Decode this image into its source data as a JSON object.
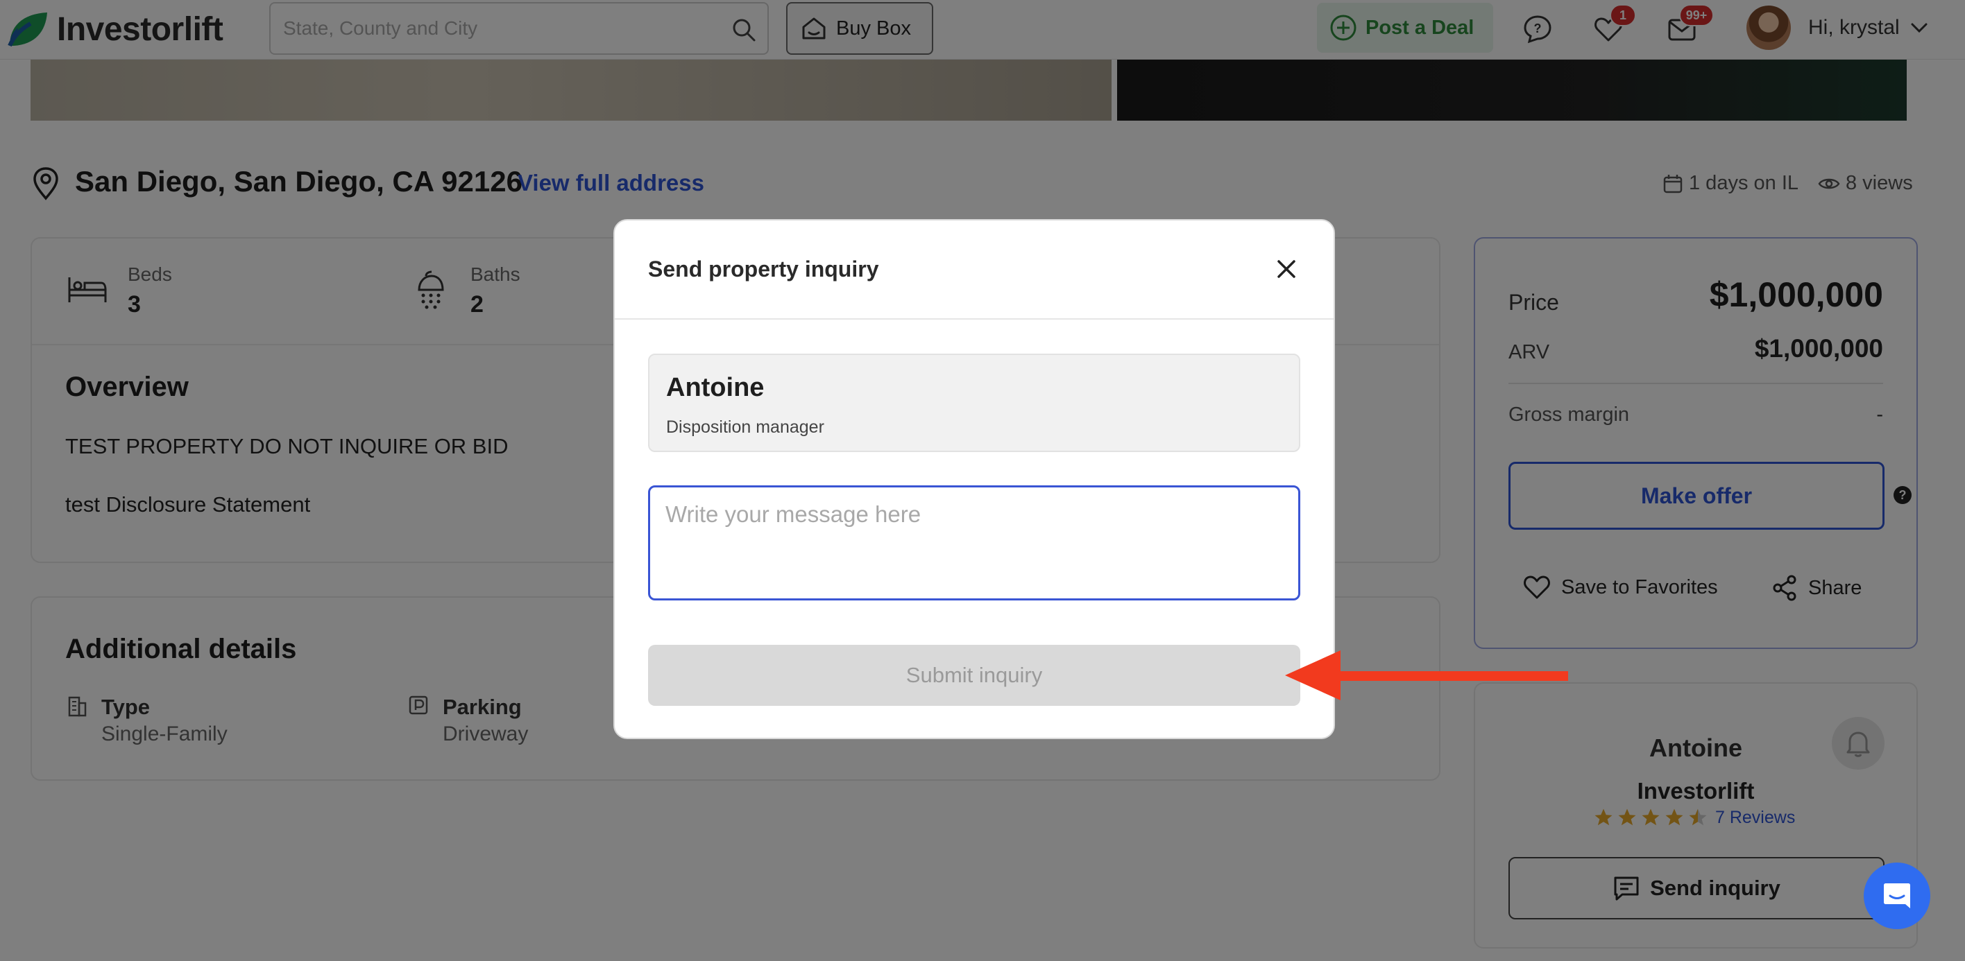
{
  "header": {
    "logo_text": "Investorlift",
    "search_placeholder": "State, County and City",
    "buy_box_label": "Buy Box",
    "post_deal_label": "Post a Deal",
    "favorites_badge": "1",
    "messages_badge": "99+",
    "greeting": "Hi, krystal"
  },
  "property": {
    "address": "San Diego, San Diego, CA 92126",
    "view_full_address": "View full address",
    "days_on": "1 days on IL",
    "views": "8 views",
    "beds_label": "Beds",
    "beds_value": "3",
    "baths_label": "Baths",
    "baths_value": "2",
    "overview_heading": "Overview",
    "overview_text": "TEST PROPERTY DO NOT INQUIRE OR BID",
    "disclosure_text": "test Disclosure Statement",
    "additional_heading": "Additional details",
    "type_label": "Type",
    "type_value": "Single-Family",
    "parking_label": "Parking",
    "parking_value": "Driveway"
  },
  "pricing": {
    "price_label": "Price",
    "price_value": "$1,000,000",
    "arv_label": "ARV",
    "arv_value": "$1,000,000",
    "gross_margin_label": "Gross margin",
    "gross_margin_value": "-",
    "make_offer": "Make offer",
    "save_favorites": "Save to Favorites",
    "share": "Share"
  },
  "agent_card": {
    "name": "Antoine",
    "company": "Investorlift",
    "rating": 4.5,
    "reviews": "7 Reviews",
    "send_inquiry": "Send inquiry"
  },
  "modal": {
    "title": "Send property inquiry",
    "contact_name": "Antoine",
    "contact_role": "Disposition manager",
    "message_placeholder": "Write your message here",
    "submit_label": "Submit inquiry"
  },
  "colors": {
    "accent_blue": "#2f55d4",
    "brand_green": "#2f8a3c",
    "badge_red": "#d52d2d",
    "annotation_red": "#f23a1e"
  }
}
